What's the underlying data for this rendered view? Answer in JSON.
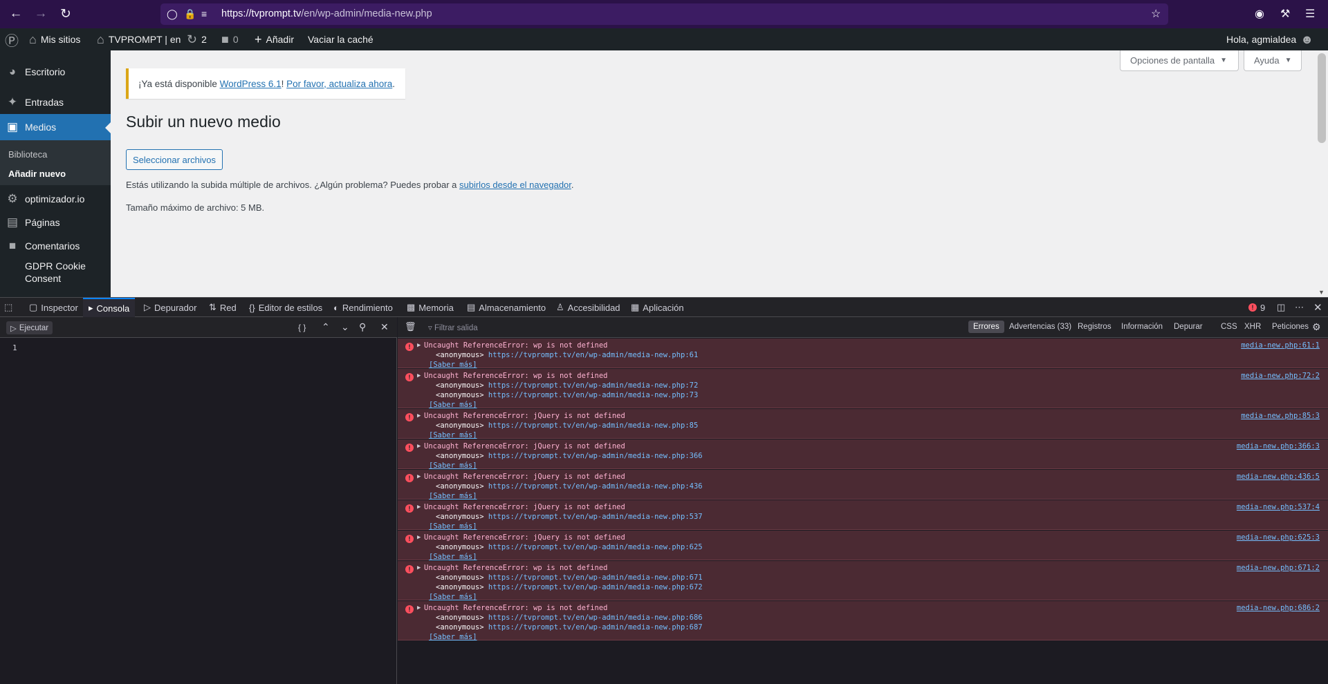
{
  "browser": {
    "url_host": "https://tvprompt.tv",
    "url_path": "/en/wp-admin/media-new.php"
  },
  "adminbar": {
    "my_sites": "Mis sitios",
    "site": "TVPROMPT | en",
    "updates": "2",
    "comments": "0",
    "add_new": "Añadir",
    "clear_cache": "Vaciar la caché",
    "greeting": "Hola, agmialdea"
  },
  "sidebar": {
    "escritorio": "Escritorio",
    "entradas": "Entradas",
    "medios": "Medios",
    "biblioteca": "Biblioteca",
    "anadir_nuevo": "Añadir nuevo",
    "optimizador": "optimizador.io",
    "paginas": "Páginas",
    "comentarios": "Comentarios",
    "gdpr_1": "GDPR Cookie",
    "gdpr_2": "Consent"
  },
  "main": {
    "notice_pre": "¡Ya está disponible ",
    "notice_link1": "WordPress 6.1",
    "notice_mid": "! ",
    "notice_link2": "Por favor, actualiza ahora",
    "notice_end": ".",
    "screen_options": "Opciones de pantalla",
    "help": "Ayuda",
    "title": "Subir un nuevo medio",
    "select_files": "Seleccionar archivos",
    "multi_upload_pre": "Estás utilizando la subida múltiple de archivos. ¿Algún problema? Puedes probar a ",
    "multi_upload_link": "subirlos desde el navegador",
    "multi_upload_end": ".",
    "max_size": "Tamaño máximo de archivo: 5 MB."
  },
  "devtools": {
    "tabs": [
      "Inspector",
      "Consola",
      "Depurador",
      "Red",
      "Editor de estilos",
      "Rendimiento",
      "Memoria",
      "Almacenamiento",
      "Accesibilidad",
      "Aplicación"
    ],
    "error_count": "9",
    "run": "Ejecutar",
    "line": "1",
    "filter_placeholder": "Filtrar salida",
    "filters": [
      "Errores",
      "Advertencias (33)",
      "Registros",
      "Información",
      "Depurar",
      "CSS",
      "XHR",
      "Peticiones"
    ],
    "learn_more": "[Saber más]",
    "anon": "<anonymous>",
    "messages": [
      {
        "text": "Uncaught ReferenceError: wp is not defined",
        "stack": [
          "https://tvprompt.tv/en/wp-admin/media-new.php:61"
        ],
        "loc": "media-new.php:61:1"
      },
      {
        "text": "Uncaught ReferenceError: wp is not defined",
        "stack": [
          "https://tvprompt.tv/en/wp-admin/media-new.php:72",
          "https://tvprompt.tv/en/wp-admin/media-new.php:73"
        ],
        "loc": "media-new.php:72:2"
      },
      {
        "text": "Uncaught ReferenceError: jQuery is not defined",
        "stack": [
          "https://tvprompt.tv/en/wp-admin/media-new.php:85"
        ],
        "loc": "media-new.php:85:3"
      },
      {
        "text": "Uncaught ReferenceError: jQuery is not defined",
        "stack": [
          "https://tvprompt.tv/en/wp-admin/media-new.php:366"
        ],
        "loc": "media-new.php:366:3"
      },
      {
        "text": "Uncaught ReferenceError: jQuery is not defined",
        "stack": [
          "https://tvprompt.tv/en/wp-admin/media-new.php:436"
        ],
        "loc": "media-new.php:436:5"
      },
      {
        "text": "Uncaught ReferenceError: jQuery is not defined",
        "stack": [
          "https://tvprompt.tv/en/wp-admin/media-new.php:537"
        ],
        "loc": "media-new.php:537:4"
      },
      {
        "text": "Uncaught ReferenceError: jQuery is not defined",
        "stack": [
          "https://tvprompt.tv/en/wp-admin/media-new.php:625"
        ],
        "loc": "media-new.php:625:3"
      },
      {
        "text": "Uncaught ReferenceError: wp is not defined",
        "stack": [
          "https://tvprompt.tv/en/wp-admin/media-new.php:671",
          "https://tvprompt.tv/en/wp-admin/media-new.php:672"
        ],
        "loc": "media-new.php:671:2"
      },
      {
        "text": "Uncaught ReferenceError: wp is not defined",
        "stack": [
          "https://tvprompt.tv/en/wp-admin/media-new.php:686",
          "https://tvprompt.tv/en/wp-admin/media-new.php:687"
        ],
        "loc": "media-new.php:686:2"
      }
    ]
  }
}
